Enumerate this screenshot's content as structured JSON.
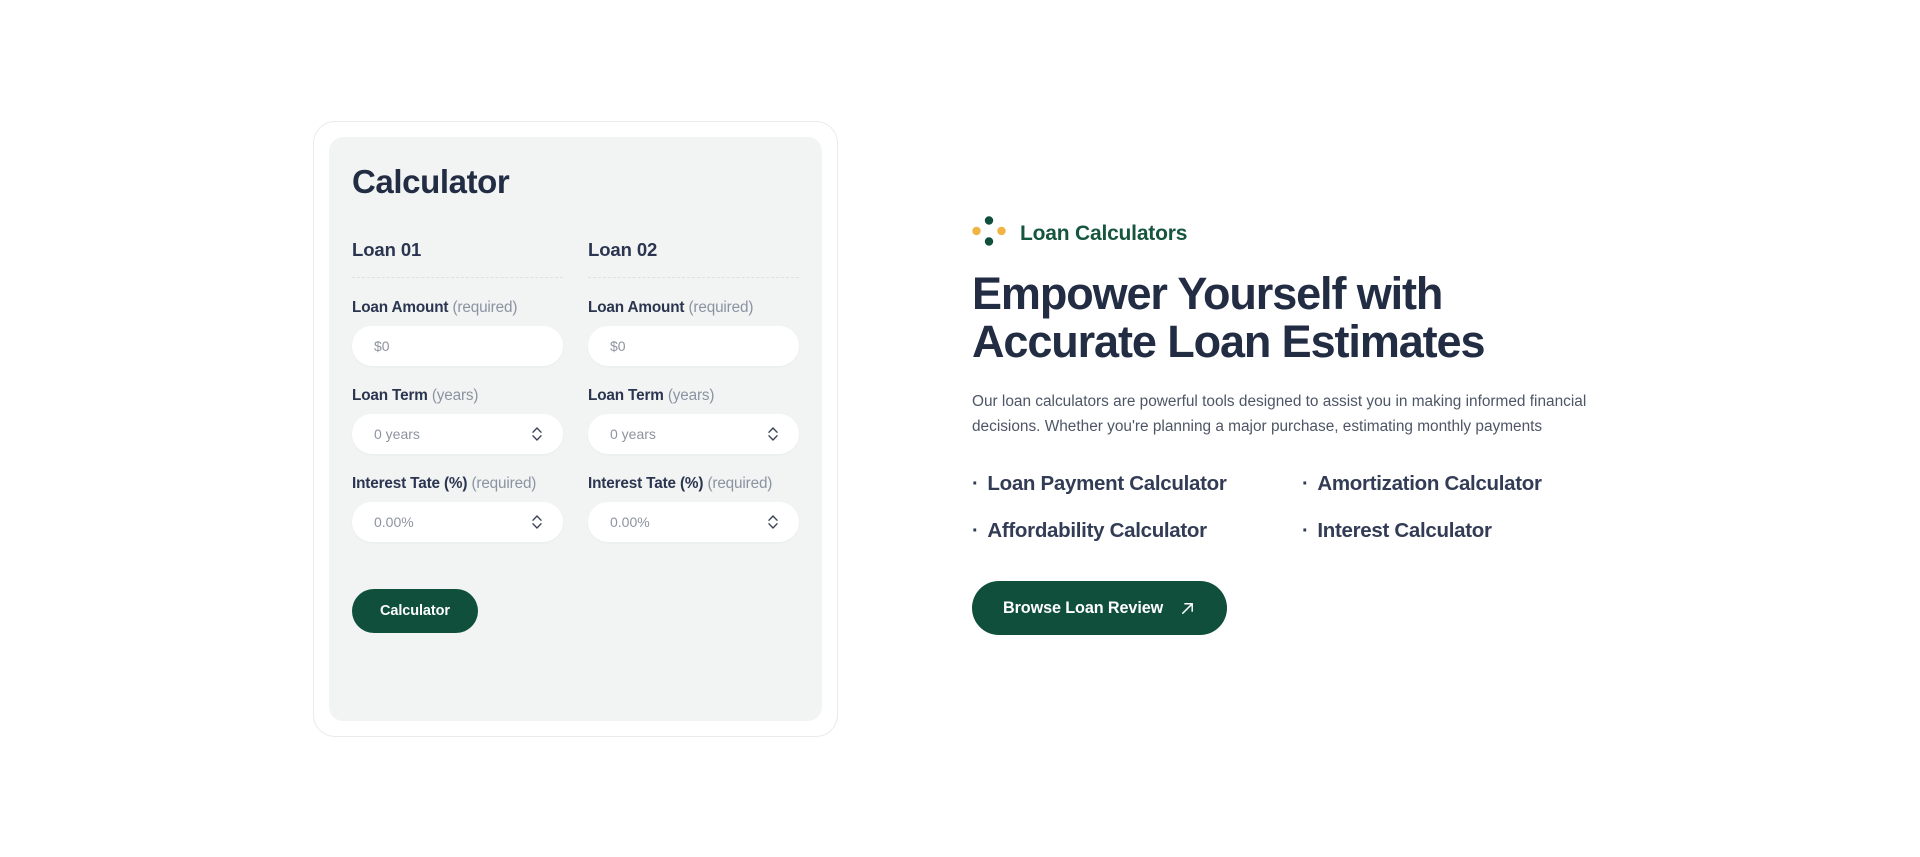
{
  "calculator": {
    "title": "Calculator",
    "submit_label": "Calculator",
    "columns": [
      {
        "heading": "Loan 01",
        "fields": [
          {
            "label": "Loan Amount",
            "qualifier": "(required)",
            "placeholder": "$0",
            "value": "",
            "stepper": false,
            "name": "loan-amount"
          },
          {
            "label": "Loan Term",
            "qualifier": "(years)",
            "placeholder": "0 years",
            "value": "",
            "stepper": true,
            "name": "loan-term"
          },
          {
            "label": "Interest Tate (%)",
            "qualifier": "(required)",
            "placeholder": "0.00%",
            "value": "",
            "stepper": true,
            "name": "interest-rate"
          }
        ]
      },
      {
        "heading": "Loan 02",
        "fields": [
          {
            "label": "Loan Amount",
            "qualifier": "(required)",
            "placeholder": "$0",
            "value": "",
            "stepper": false,
            "name": "loan-amount"
          },
          {
            "label": "Loan Term",
            "qualifier": "(years)",
            "placeholder": "0 years",
            "value": "",
            "stepper": true,
            "name": "loan-term"
          },
          {
            "label": "Interest Tate (%)",
            "qualifier": "(required)",
            "placeholder": "0.00%",
            "value": "",
            "stepper": true,
            "name": "interest-rate"
          }
        ]
      }
    ]
  },
  "info": {
    "eyebrow": "Loan Calculators",
    "eyebrow_icon": "four-dot-diamond-icon",
    "headline": "Empower Yourself with Accurate Loan Estimates",
    "blurb": "Our loan calculators are powerful tools designed to assist you in making informed financial decisions. Whether you're planning a major purchase, estimating monthly payments",
    "bullet_marker": "·",
    "bullets": [
      "Loan Payment Calculator",
      "Amortization Calculator",
      "Affordability Calculator",
      "Interest Calculator"
    ],
    "cta_label": "Browse Loan Review",
    "cta_icon": "arrow-up-right-icon"
  },
  "colors": {
    "brand_green": "#0F4F3C",
    "eyebrow_green": "#16563F",
    "accent_orange": "#F0B442",
    "heading_navy": "#222C43",
    "panel_bg": "#F1F4F3",
    "page_bg": "#FFFFFF"
  }
}
